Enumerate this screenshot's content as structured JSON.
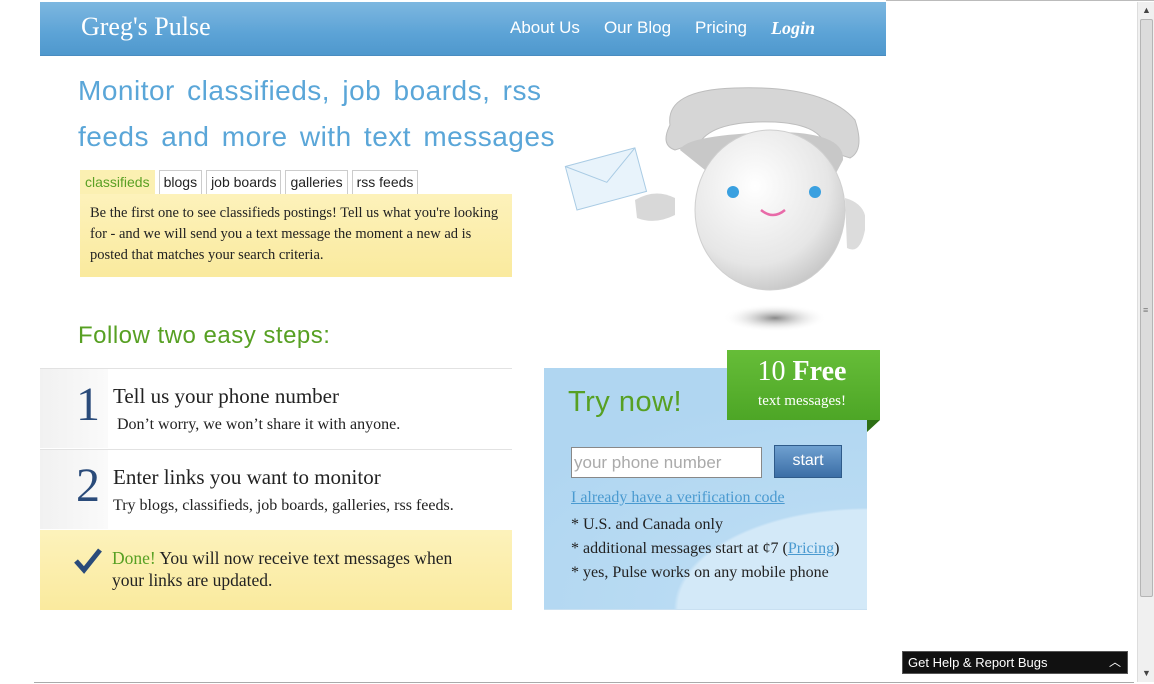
{
  "header": {
    "brand": "Greg's Pulse",
    "nav": [
      "About Us",
      "Our Blog",
      "Pricing"
    ],
    "login": "Login"
  },
  "headline": "Monitor classifieds, job boards, rss feeds and more with text messages",
  "tabs": {
    "items": [
      "classifieds",
      "blogs",
      "job boards",
      "galleries",
      "rss feeds"
    ],
    "active": "classifieds",
    "panel_text": "Be the first one to see classifieds postings! Tell us what you're looking for - and we will send you a text message the moment a new ad is posted that matches your search criteria."
  },
  "steps": {
    "title": "Follow two easy steps:",
    "items": [
      {
        "num": "1",
        "title": "Tell us your phone number",
        "sub": "Don’t worry, we won’t share it with anyone."
      },
      {
        "num": "2",
        "title": "Enter links you want to monitor",
        "sub": "Try blogs, classifieds, job boards, galleries, rss feeds."
      }
    ],
    "done_word": "Done!",
    "done_text": " You will now receive text messages when your links are updated."
  },
  "try_box": {
    "title": "Try now!",
    "phone_placeholder": "your phone number",
    "start_label": "start",
    "verify_link": "I already have a verification code",
    "note1": "* U.S. and Canada only",
    "note2_prefix": "* additional messages start at ¢7 (",
    "note2_link": "Pricing",
    "note2_suffix": ")",
    "note3": "* yes, Pulse works on any mobile phone"
  },
  "ribbon": {
    "num": "10",
    "word": "Free",
    "sub": "text messages!"
  },
  "help_bar": {
    "label": "Get Help & Report Bugs"
  },
  "colors": {
    "header_blue": "#5ca3d6",
    "headline_blue": "#5aa6d8",
    "green": "#57a023",
    "step_number": "#2a4b7a",
    "panel_yellow": "#fbf0b2",
    "link_blue": "#4a9ad0"
  }
}
